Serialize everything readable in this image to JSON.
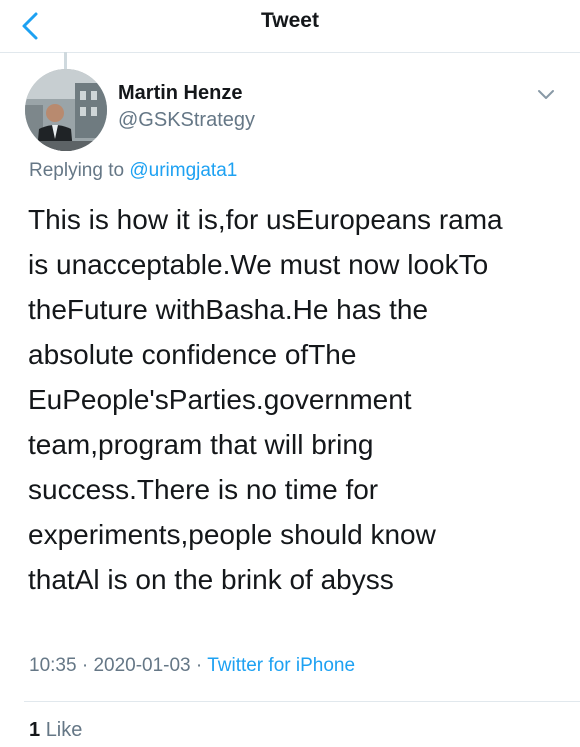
{
  "header": {
    "title": "Tweet",
    "back_icon": "chevron-left-icon",
    "accent_color": "#1da1f2"
  },
  "tweet": {
    "author_name": "Martin Henze",
    "author_handle": "@GSKStrategy",
    "avatar_icon": "profile-photo",
    "menu_icon": "chevron-down-icon",
    "replying_prefix": "Replying to",
    "replying_handle": "@urimgjata1",
    "text_lines": [
      "This is how it is,for usEuropeans rama",
      "is unacceptable.We must now lookTo",
      "theFuture withBasha.He has the",
      "absolute confidence ofThe",
      "EuPeople'sParties.government",
      "team,program that will bring",
      "success.There is no time for",
      "experiments,people should know",
      "thatAl is on the brink of abyss"
    ],
    "time": "10:35",
    "date": "2020-01-03",
    "separator": "·",
    "source": "Twitter for iPhone",
    "likes_count": "1",
    "likes_label": "Like"
  }
}
